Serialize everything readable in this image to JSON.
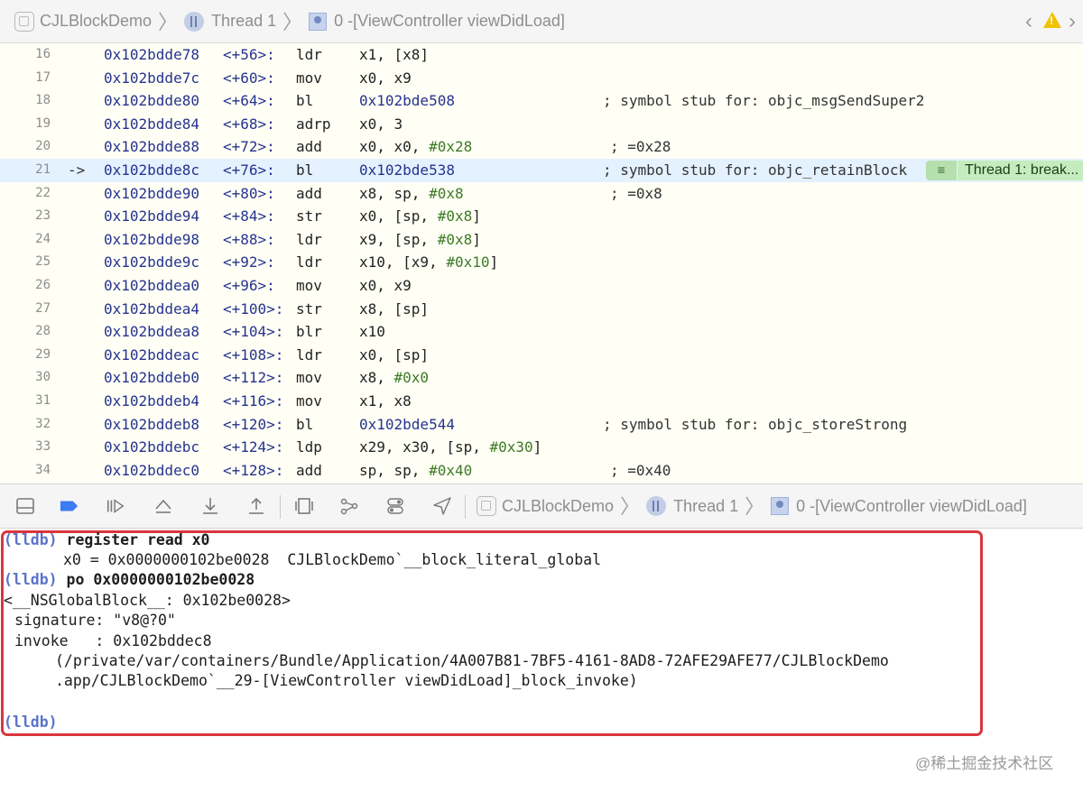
{
  "top_bar": {
    "project": "CJLBlockDemo",
    "thread": "Thread 1",
    "frame": "0 -[ViewController viewDidLoad]"
  },
  "disassembly": {
    "current_line": 21,
    "rows": [
      {
        "ln": "16",
        "addr": "0x102bdde78",
        "off": "<+56>:",
        "op": "ldr",
        "args": [
          {
            "t": "x1, [x8]",
            "c": ""
          }
        ],
        "comment": ""
      },
      {
        "ln": "17",
        "addr": "0x102bdde7c",
        "off": "<+60>:",
        "op": "mov",
        "args": [
          {
            "t": "x0, x9",
            "c": ""
          }
        ],
        "comment": ""
      },
      {
        "ln": "18",
        "addr": "0x102bdde80",
        "off": "<+64>:",
        "op": "bl",
        "args": [
          {
            "t": "0x102bde508",
            "c": "tgt"
          }
        ],
        "comment": "; symbol stub for: objc_msgSendSuper2"
      },
      {
        "ln": "19",
        "addr": "0x102bdde84",
        "off": "<+68>:",
        "op": "adrp",
        "args": [
          {
            "t": "x0, 3",
            "c": ""
          }
        ],
        "comment": ""
      },
      {
        "ln": "20",
        "addr": "0x102bdde88",
        "off": "<+72>:",
        "op": "add",
        "args": [
          {
            "t": "x0, x0, ",
            "c": ""
          },
          {
            "t": "#0x28",
            "c": "imm"
          }
        ],
        "comment_val": "; =0x28"
      },
      {
        "ln": "21",
        "arrow": "->",
        "addr": "0x102bdde8c",
        "off": "<+76>:",
        "op": "bl",
        "args": [
          {
            "t": "0x102bde538",
            "c": "tgt"
          }
        ],
        "comment": "; symbol stub for: objc_retainBlock"
      },
      {
        "ln": "22",
        "addr": "0x102bdde90",
        "off": "<+80>:",
        "op": "add",
        "args": [
          {
            "t": "x8, sp, ",
            "c": ""
          },
          {
            "t": "#0x8",
            "c": "imm"
          }
        ],
        "comment_val": "; =0x8"
      },
      {
        "ln": "23",
        "addr": "0x102bdde94",
        "off": "<+84>:",
        "op": "str",
        "args": [
          {
            "t": "x0, [sp, ",
            "c": ""
          },
          {
            "t": "#0x8",
            "c": "imm"
          },
          {
            "t": "]",
            "c": ""
          }
        ],
        "comment": ""
      },
      {
        "ln": "24",
        "addr": "0x102bdde98",
        "off": "<+88>:",
        "op": "ldr",
        "args": [
          {
            "t": "x9, [sp, ",
            "c": ""
          },
          {
            "t": "#0x8",
            "c": "imm"
          },
          {
            "t": "]",
            "c": ""
          }
        ],
        "comment": ""
      },
      {
        "ln": "25",
        "addr": "0x102bdde9c",
        "off": "<+92>:",
        "op": "ldr",
        "args": [
          {
            "t": "x10, [x9, ",
            "c": ""
          },
          {
            "t": "#0x10",
            "c": "imm"
          },
          {
            "t": "]",
            "c": ""
          }
        ],
        "comment": ""
      },
      {
        "ln": "26",
        "addr": "0x102bddea0",
        "off": "<+96>:",
        "op": "mov",
        "args": [
          {
            "t": "x0, x9",
            "c": ""
          }
        ],
        "comment": ""
      },
      {
        "ln": "27",
        "addr": "0x102bddea4",
        "off": "<+100>:",
        "op": "str",
        "args": [
          {
            "t": "x8, [sp]",
            "c": ""
          }
        ],
        "comment": ""
      },
      {
        "ln": "28",
        "addr": "0x102bddea8",
        "off": "<+104>:",
        "op": "blr",
        "args": [
          {
            "t": "x10",
            "c": ""
          }
        ],
        "comment": ""
      },
      {
        "ln": "29",
        "addr": "0x102bddeac",
        "off": "<+108>:",
        "op": "ldr",
        "args": [
          {
            "t": "x0, [sp]",
            "c": ""
          }
        ],
        "comment": ""
      },
      {
        "ln": "30",
        "addr": "0x102bddeb0",
        "off": "<+112>:",
        "op": "mov",
        "args": [
          {
            "t": "x8, ",
            "c": ""
          },
          {
            "t": "#0x0",
            "c": "imm"
          }
        ],
        "comment": ""
      },
      {
        "ln": "31",
        "addr": "0x102bddeb4",
        "off": "<+116>:",
        "op": "mov",
        "args": [
          {
            "t": "x1, x8",
            "c": ""
          }
        ],
        "comment": ""
      },
      {
        "ln": "32",
        "addr": "0x102bddeb8",
        "off": "<+120>:",
        "op": "bl",
        "args": [
          {
            "t": "0x102bde544",
            "c": "tgt"
          }
        ],
        "comment": "; symbol stub for: objc_storeStrong"
      },
      {
        "ln": "33",
        "addr": "0x102bddebc",
        "off": "<+124>:",
        "op": "ldp",
        "args": [
          {
            "t": "x29, x30, [sp, ",
            "c": ""
          },
          {
            "t": "#0x30",
            "c": "imm"
          },
          {
            "t": "]",
            "c": ""
          }
        ],
        "comment": ""
      },
      {
        "ln": "34",
        "addr": "0x102bddec0",
        "off": "<+128>:",
        "op": "add",
        "args": [
          {
            "t": "sp, sp, ",
            "c": ""
          },
          {
            "t": "#0x40",
            "c": "imm"
          }
        ],
        "comment_val": "; =0x40"
      }
    ],
    "breakpoint_badge": "Thread 1: break..."
  },
  "debug_bar": {
    "icons": [
      "hide-console-icon",
      "breakpoints-toggle-icon",
      "continue-icon",
      "step-over-icon",
      "step-into-icon",
      "step-out-icon",
      "view-debugger-icon",
      "memory-graph-icon",
      "environment-overrides-icon",
      "simulate-location-icon"
    ],
    "project": "CJLBlockDemo",
    "thread": "Thread 1",
    "frame": "0 -[ViewController viewDidLoad]"
  },
  "console": {
    "prompt": "(lldb)",
    "cmd1": "register read x0",
    "out1": "x0 = 0x0000000102be0028  CJLBlockDemo`__block_literal_global",
    "cmd2": "po 0x0000000102be0028",
    "out2": "<__NSGlobalBlock__: 0x102be0028>",
    "out3": "signature: \"v8@?0\"",
    "out4": "invoke   : 0x102bddec8",
    "out5": "(/private/var/containers/Bundle/Application/4A007B81-7BF5-4161-8AD8-72AFE29AFE77/CJLBlockDemo",
    "out6": ".app/CJLBlockDemo`__29-[ViewController viewDidLoad]_block_invoke)"
  },
  "watermark": "@稀土掘金技术社区",
  "colors": {
    "highlight": "#e4f1ff",
    "breakpoint_badge": "#c4ecbe",
    "console_border": "#d9363e",
    "prompt": "#5a73c8"
  }
}
